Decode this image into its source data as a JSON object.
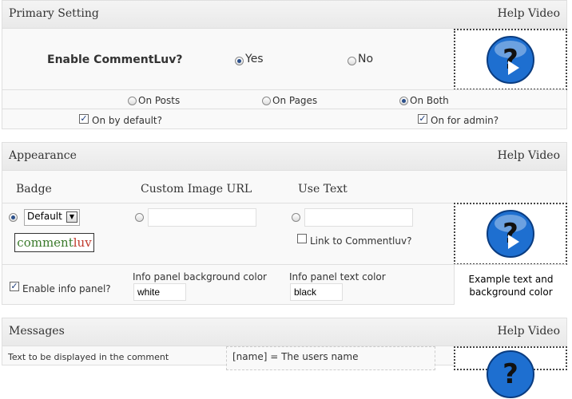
{
  "primary": {
    "title": "Primary Setting",
    "help": "Help Video",
    "enable_label": "Enable CommentLuv?",
    "yes": "Yes",
    "no": "No",
    "on_posts": "On Posts",
    "on_pages": "On Pages",
    "on_both": "On Both",
    "on_default": "On by default?",
    "on_admin": "On for admin?"
  },
  "appearance": {
    "title": "Appearance",
    "help": "Help Video",
    "col_badge": "Badge",
    "col_custom": "Custom Image URL",
    "col_text": "Use Text",
    "badge_select": "Default",
    "badge_logo_a": "comment",
    "badge_logo_b": "luv",
    "link_label": "Link to Commentluv?",
    "enable_info": "Enable info panel?",
    "bg_color_label": "Info panel background color",
    "bg_color_value": "white",
    "text_color_label": "Info panel text color",
    "text_color_value": "black",
    "example": "Example text and background color"
  },
  "messages": {
    "title": "Messages",
    "help": "Help Video",
    "text_label": "Text to be displayed in the comment",
    "name_hint": "[name] = The users name"
  },
  "colors": {
    "logo_green": "#3a7a2a",
    "logo_red": "#c0392b",
    "help_blue": "#1e6fd0"
  }
}
